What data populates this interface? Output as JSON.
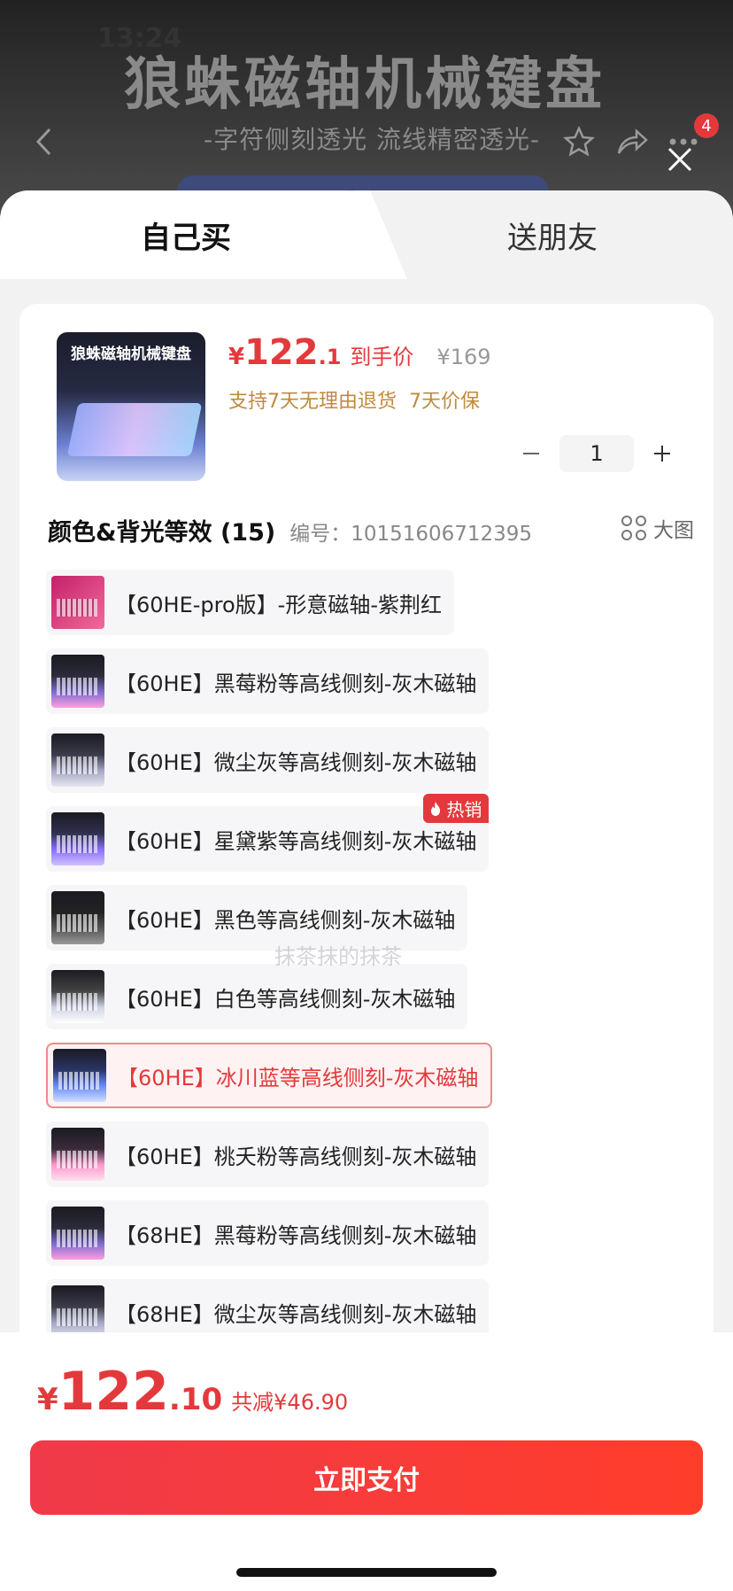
{
  "status_bar": {
    "time": "13:24"
  },
  "background_page": {
    "banner_title": "狼蛛磁轴机械键盘",
    "banner_subtitle": "-字符侧刻透光 流线精密透光-",
    "cart_count": "4"
  },
  "tabs": [
    {
      "label": "自己买",
      "active": true
    },
    {
      "label": "送朋友",
      "active": false
    }
  ],
  "product": {
    "thumbnail_title": "狼蛛磁轴机械键盘",
    "price_symbol": "¥",
    "price_integer": "122",
    "price_decimal": ".1",
    "price_label": "到手价",
    "original_price": "¥169",
    "guarantees": "支持7天无理由退货  7天价保",
    "quantity": "1"
  },
  "section": {
    "title": "颜色&背光等效 (15)",
    "code": "编号：10151606712395",
    "big_view_label": "大图"
  },
  "variants": [
    {
      "label": "【60HE-pro版】-形意磁轴-紫荆红",
      "swatch": "pro",
      "selected": false,
      "hot": false
    },
    {
      "label": "【60HE】黑莓粉等高线侧刻-灰木磁轴",
      "swatch": "pink",
      "selected": false,
      "hot": false
    },
    {
      "label": "【60HE】微尘灰等高线侧刻-灰木磁轴",
      "swatch": "gray",
      "selected": false,
      "hot": false
    },
    {
      "label": "【60HE】星黛紫等高线侧刻-灰木磁轴",
      "swatch": "purple",
      "selected": false,
      "hot": true
    },
    {
      "label": "【60HE】黑色等高线侧刻-灰木磁轴",
      "swatch": "black",
      "selected": false,
      "hot": false
    },
    {
      "label": "【60HE】白色等高线侧刻-灰木磁轴",
      "swatch": "white",
      "selected": false,
      "hot": false
    },
    {
      "label": "【60HE】冰川蓝等高线侧刻-灰木磁轴",
      "swatch": "ice",
      "selected": true,
      "hot": false
    },
    {
      "label": "【60HE】桃夭粉等高线侧刻-灰木磁轴",
      "swatch": "peach",
      "selected": false,
      "hot": false
    },
    {
      "label": "【68HE】黑莓粉等高线侧刻-灰木磁轴",
      "swatch": "pink",
      "selected": false,
      "hot": false
    },
    {
      "label": "【68HE】微尘灰等高线侧刻-灰木磁轴",
      "swatch": "gray",
      "selected": false,
      "hot": false
    }
  ],
  "hot_tag": "热销",
  "watermark": "抹茶抹的抹茶",
  "footer": {
    "total_symbol": "¥",
    "total_integer": "122",
    "total_decimal": ".10",
    "savings": "共减¥46.90",
    "pay_button": "立即支付"
  },
  "colors": {
    "accent": "#e4393c",
    "guarantee": "#c08a3e"
  },
  "icons": [
    "back-icon",
    "star-icon",
    "share-icon",
    "more-icon",
    "close-icon",
    "minus-icon",
    "plus-icon",
    "grid-icon",
    "flame-icon"
  ]
}
